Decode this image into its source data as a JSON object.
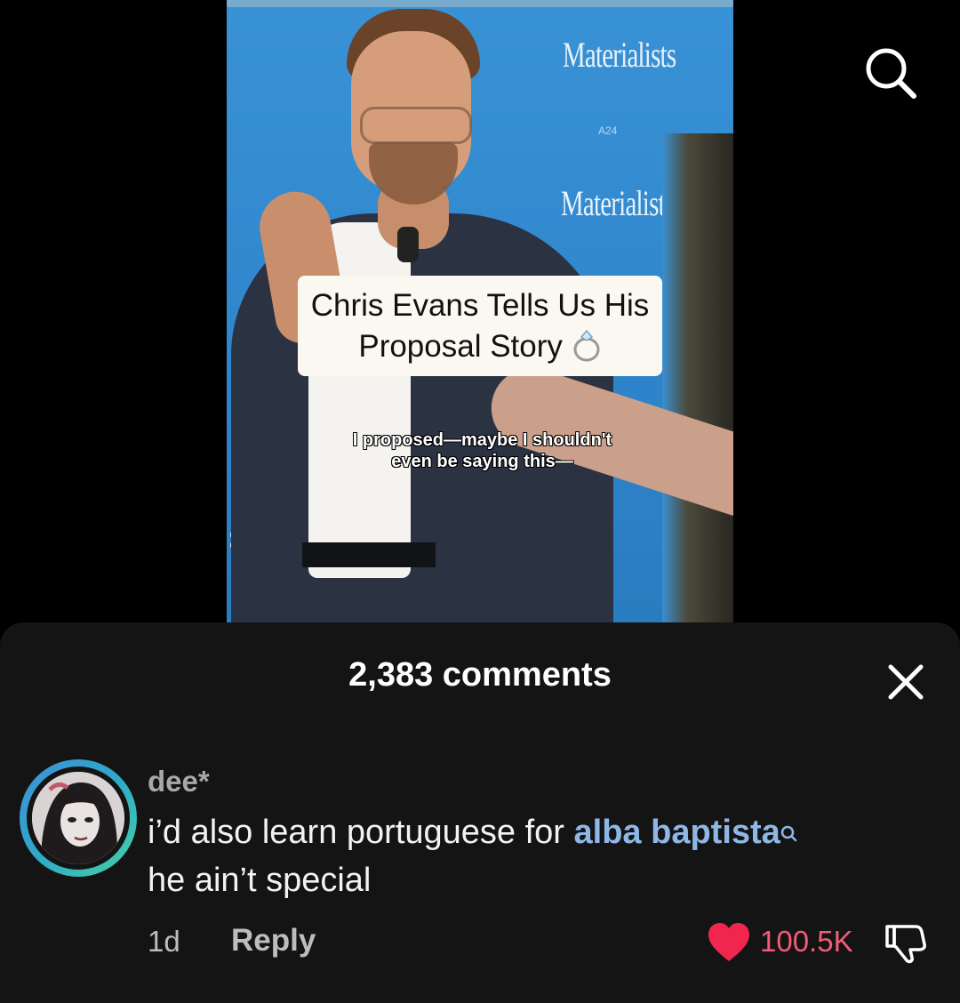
{
  "video": {
    "backdrop_logo": "Materialists",
    "backdrop_sublabel": "A24",
    "headline": "Chris Evans Tells Us His Proposal Story",
    "headline_emoji": "ring-icon",
    "subtitle_line1": "I proposed—maybe I shouldn't",
    "subtitle_line2": "even be saying this—",
    "edge_letter": "S"
  },
  "top_bar": {
    "search_icon": "search-icon"
  },
  "comments_sheet": {
    "title": "2,383 comments",
    "close_icon": "close-icon"
  },
  "comment": {
    "username": "dee*",
    "text_before": "i’d also learn portuguese for ",
    "mention": "alba baptista",
    "text_after": "he ain’t special",
    "time": "1d",
    "reply_label": "Reply",
    "like_count": "100.5K",
    "liked": true,
    "colors": {
      "like": "#f0264f",
      "mention": "#8fb7e6",
      "ring_start": "#3f8fd8",
      "ring_end": "#47d2a2"
    }
  }
}
